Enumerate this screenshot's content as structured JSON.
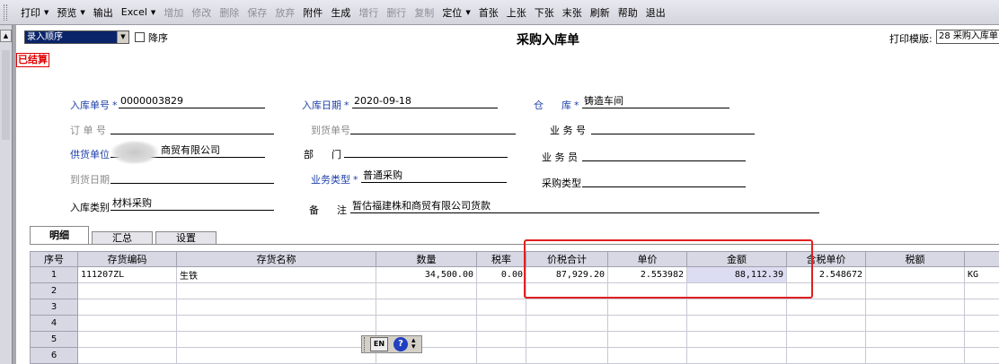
{
  "toolbar": [
    {
      "label": "打印",
      "arrow": true,
      "enabled": true
    },
    {
      "label": "预览",
      "arrow": true,
      "enabled": true
    },
    {
      "label": "输出",
      "arrow": false,
      "enabled": true
    },
    {
      "label": "Excel",
      "arrow": true,
      "enabled": true
    },
    {
      "label": "增加",
      "arrow": false,
      "enabled": false
    },
    {
      "label": "修改",
      "arrow": false,
      "enabled": false
    },
    {
      "label": "删除",
      "arrow": false,
      "enabled": false
    },
    {
      "label": "保存",
      "arrow": false,
      "enabled": false
    },
    {
      "label": "放弃",
      "arrow": false,
      "enabled": false
    },
    {
      "label": "附件",
      "arrow": false,
      "enabled": true
    },
    {
      "label": "生成",
      "arrow": false,
      "enabled": true
    },
    {
      "label": "增行",
      "arrow": false,
      "enabled": false
    },
    {
      "label": "删行",
      "arrow": false,
      "enabled": false
    },
    {
      "label": "复制",
      "arrow": false,
      "enabled": false
    },
    {
      "label": "定位",
      "arrow": true,
      "enabled": true
    },
    {
      "label": "首张",
      "arrow": false,
      "enabled": true
    },
    {
      "label": "上张",
      "arrow": false,
      "enabled": true
    },
    {
      "label": "下张",
      "arrow": false,
      "enabled": true
    },
    {
      "label": "末张",
      "arrow": false,
      "enabled": true
    },
    {
      "label": "刷新",
      "arrow": false,
      "enabled": true
    },
    {
      "label": "帮助",
      "arrow": false,
      "enabled": true
    },
    {
      "label": "退出",
      "arrow": false,
      "enabled": true
    }
  ],
  "header": {
    "sort_select": "录入顺序",
    "descending_label": "降序",
    "title": "采购入库单",
    "print_template_label": "打印模版:",
    "print_template_value": "28 采购入库单"
  },
  "status_stamp": "已结算",
  "form": {
    "receipt_no_label": "入库单号",
    "receipt_no": "0000003829",
    "receipt_date_label": "入库日期",
    "receipt_date": "2020-09-18",
    "warehouse_label_a": "仓",
    "warehouse_label_b": "库",
    "warehouse": "铸造车间",
    "order_no_label": "订 单 号",
    "order_no": "",
    "arrival_no_label": "到货单号",
    "arrival_no": "",
    "business_no_label": "业 务 号",
    "business_no": "",
    "supplier_label": "供货单位",
    "supplier": "商贸有限公司",
    "dept_label_a": "部",
    "dept_label_b": "门",
    "dept": "",
    "salesman_label": "业 务 员",
    "salesman": "",
    "arrival_date_label": "到货日期",
    "arrival_date": "",
    "business_type_label": "业务类型",
    "business_type": "普通采购",
    "purchase_type_label": "采购类型",
    "purchase_type": "",
    "category_label": "入库类别",
    "category": "材料采购",
    "remark_label_a": "备",
    "remark_label_b": "注",
    "remark": "暂估福建株和商贸有限公司货款"
  },
  "tabs": [
    "明细",
    "汇总",
    "设置"
  ],
  "grid": {
    "columns": [
      "序号",
      "存货编码",
      "存货名称",
      "数量",
      "税率",
      "价税合计",
      "单价",
      "金额",
      "含税单价",
      "税额",
      ""
    ],
    "rows": [
      [
        "1",
        "111207ZL",
        "生铁",
        "34,500.00",
        "0.00",
        "87,929.20",
        "2.553982",
        "88,112.39",
        "2.548672",
        "",
        "KG"
      ],
      [
        "2",
        "",
        "",
        "",
        "",
        "",
        "",
        "",
        "",
        "",
        ""
      ],
      [
        "3",
        "",
        "",
        "",
        "",
        "",
        "",
        "",
        "",
        "",
        ""
      ],
      [
        "4",
        "",
        "",
        "",
        "",
        "",
        "",
        "",
        "",
        "",
        ""
      ],
      [
        "5",
        "",
        "",
        "",
        "",
        "",
        "",
        "",
        "",
        "",
        ""
      ],
      [
        "6",
        "",
        "",
        "",
        "",
        "",
        "",
        "",
        "",
        "",
        ""
      ]
    ]
  },
  "ime": {
    "mode": "EN",
    "help": "?"
  }
}
